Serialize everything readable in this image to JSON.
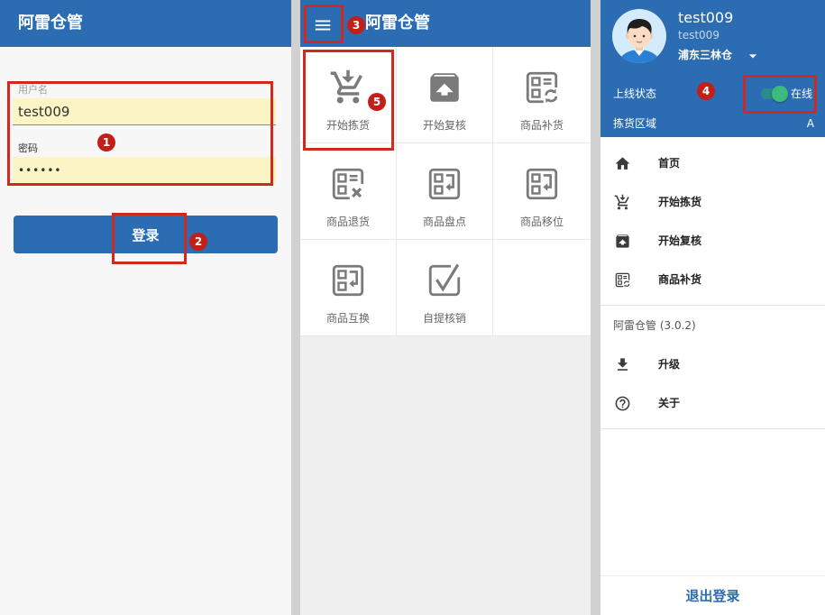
{
  "colors": {
    "brand": "#2c6cb2",
    "highlight": "#cf2a1f",
    "badge": "#c21f18",
    "autofill": "#fbf4c4",
    "toggle_track": "#2b8a8c",
    "toggle_knob": "#3dbb7e",
    "icon_gray": "#7a7a7a"
  },
  "annotations": {
    "login_fields": "1",
    "login_button": "2",
    "menu_button": "3",
    "online_status": "4",
    "pick_tile": "5"
  },
  "login_screen": {
    "title": "阿雷仓管",
    "username": {
      "label": "用户名",
      "value": "test009"
    },
    "password": {
      "label": "密码",
      "value": "••••••"
    },
    "submit_label": "登录"
  },
  "home_screen": {
    "title": "阿雷仓管",
    "menu_icon": "hamburger-menu-icon",
    "tiles": [
      {
        "label": "开始拣货",
        "icon": "cart-download-icon"
      },
      {
        "label": "开始复核",
        "icon": "unarchive-box-icon"
      },
      {
        "label": "商品补货",
        "icon": "document-refresh-icon"
      },
      {
        "label": "商品退货",
        "icon": "document-cancel-icon"
      },
      {
        "label": "商品盘点",
        "icon": "document-return-icon"
      },
      {
        "label": "商品移位",
        "icon": "document-return-icon"
      },
      {
        "label": "商品互换",
        "icon": "document-return-icon"
      },
      {
        "label": "自提核销",
        "icon": "document-check-icon"
      }
    ]
  },
  "drawer": {
    "avatar": "user-avatar-icon",
    "user": {
      "name": "test009",
      "account": "test009",
      "warehouse": "浦东三林仓"
    },
    "dropdown_icon": "caret-down-icon",
    "status": {
      "label": "上线状态",
      "value": "在线",
      "on": true
    },
    "zone": {
      "label": "拣货区域",
      "value": "A"
    },
    "menu": [
      {
        "label": "首页",
        "icon": "home-icon"
      },
      {
        "label": "开始拣货",
        "icon": "cart-download-icon"
      },
      {
        "label": "开始复核",
        "icon": "unarchive-box-icon"
      },
      {
        "label": "商品补货",
        "icon": "document-refresh-icon"
      }
    ],
    "version": "阿雷仓管 (3.0.2)",
    "extra_menu": [
      {
        "label": "升级",
        "icon": "download-icon"
      },
      {
        "label": "关于",
        "icon": "help-circle-icon"
      }
    ],
    "logout_label": "退出登录"
  }
}
